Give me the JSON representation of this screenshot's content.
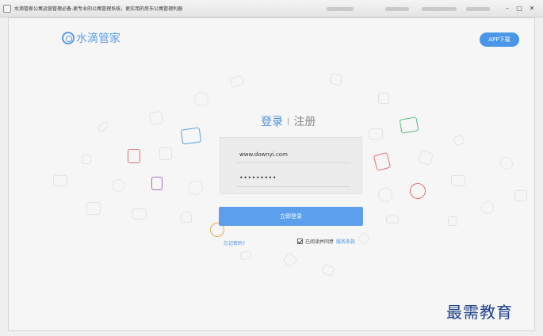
{
  "window": {
    "title": "水滴管家公寓运营管理必备-更专业的公寓管理系统，更实用的房东公寓管理利器"
  },
  "header": {
    "logo_text": "水滴管家",
    "app_download": "APP下载"
  },
  "tabs": {
    "login": "登录",
    "separator": "|",
    "register": "注册"
  },
  "form": {
    "username_value": "www.downyi.com",
    "password_value": "•••••••••",
    "login_button": "立即登录",
    "forgot_password": "忘记密码?",
    "agree_text": "已阅读并同意",
    "terms_link": "服务条款"
  },
  "watermark": "最需教育",
  "colors": {
    "accent": "#5aa0ec",
    "link": "#4a90e2"
  }
}
